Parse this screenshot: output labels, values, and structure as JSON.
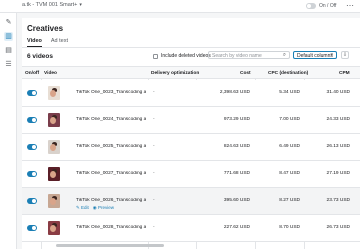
{
  "topbar": {
    "breadcrumb": "a.tk - TVM 001 Smart+",
    "toggle_label": "On / Off",
    "more_icon": "more-icon"
  },
  "rail": {
    "logo": "tiktok-logo",
    "items": [
      "edit-icon",
      "chart-icon",
      "book-icon",
      "list-icon"
    ]
  },
  "page": {
    "title": "Creatives",
    "tabs": [
      "Video",
      "Ad text"
    ],
    "active_tab": "Video",
    "count": "6 videos",
    "include_deleted_label": "Include deleted videos",
    "search_placeholder": "Search by video name",
    "columns_button": "Default columns"
  },
  "table": {
    "headers": {
      "onoff": "On/off",
      "video": "Video",
      "delivery": "Delivery optimization",
      "cost": "Cost",
      "cpc": "CPC (destination)",
      "cpm": "CPM"
    },
    "rows": [
      {
        "name": "TikTok One_0023_Transcoding and Y...",
        "delivery": "-",
        "cost": "2,398.63 USD",
        "cpc": "5.34 USD",
        "cpm": "31.40 USD",
        "thumb_color": "#e8ded4"
      },
      {
        "name": "TikTok One_0024_Transcoding and Y...",
        "delivery": "-",
        "cost": "973.29 USD",
        "cpc": "7.00 USD",
        "cpm": "24.33 USD",
        "thumb_color": "#7a3d4a"
      },
      {
        "name": "TikTok One_0025_Transcoding and Y...",
        "delivery": "-",
        "cost": "824.63 USD",
        "cpc": "6.49 USD",
        "cpm": "26.13 USD",
        "thumb_color": "#d9d2cc"
      },
      {
        "name": "TikTok One_0027_Transcoding and Y...",
        "delivery": "-",
        "cost": "771.68 USD",
        "cpc": "8.47 USD",
        "cpm": "27.19 USD",
        "thumb_color": "#5a1f28"
      },
      {
        "name": "TikTok One_0026_Transcoding and Y...",
        "delivery": "-",
        "cost": "395.60 USD",
        "cpc": "8.27 USD",
        "cpm": "23.73 USD",
        "thumb_color": "#c7a793",
        "edit": "Edit",
        "preview": "Preview"
      },
      {
        "name": "TikTok One_0028_Transcoding and Y...",
        "delivery": "-",
        "cost": "227.62 USD",
        "cpc": "8.70 USD",
        "cpm": "26.73 USD",
        "thumb_color": "#8a3c44"
      }
    ]
  }
}
